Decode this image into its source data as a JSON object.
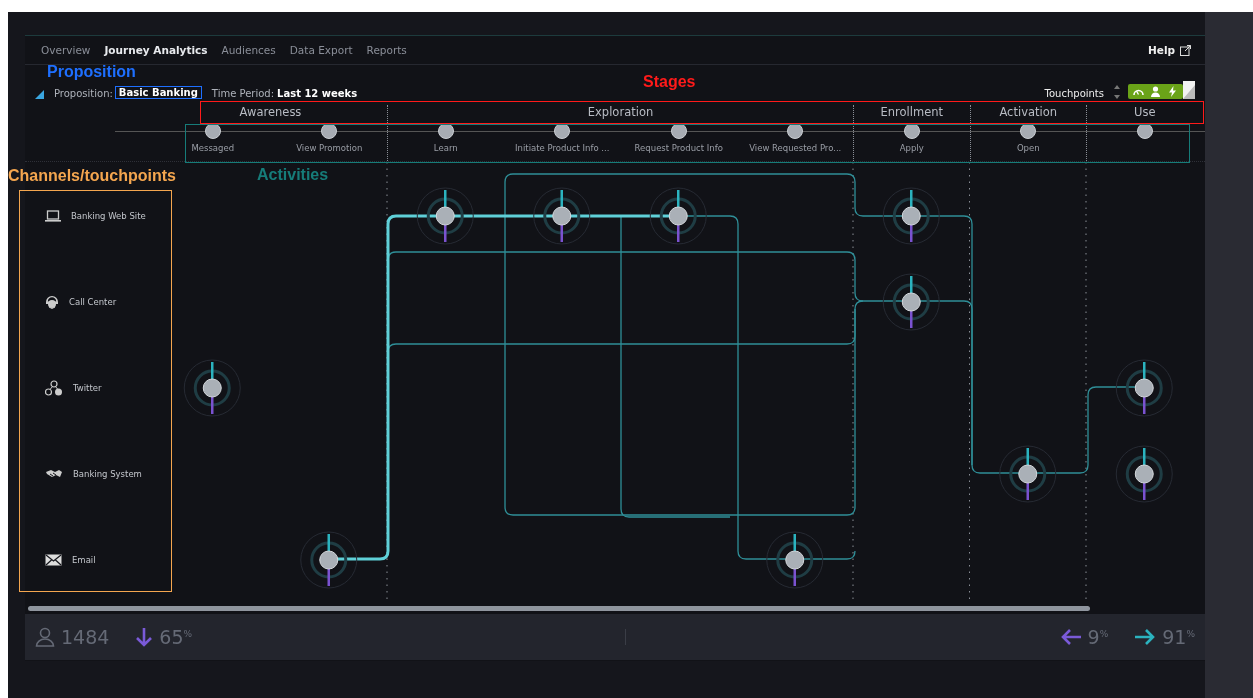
{
  "nav": {
    "tabs": [
      {
        "label": "Overview",
        "selected": false
      },
      {
        "label": "Journey Analytics",
        "selected": true
      },
      {
        "label": "Audiences",
        "selected": false
      },
      {
        "label": "Data Export",
        "selected": false
      },
      {
        "label": "Reports",
        "selected": false
      }
    ],
    "help": "Help"
  },
  "filters": {
    "proposition_label": "Proposition:",
    "proposition": "Basic Banking",
    "period_label": "Time Period:",
    "period": "Last 12 weeks",
    "view": "Touchpoints",
    "modes": [
      {
        "kind": "gauge"
      },
      {
        "kind": "person"
      },
      {
        "kind": "bolt"
      }
    ]
  },
  "stages": [
    {
      "label": "Awareness",
      "activities": [
        {
          "kind": "step",
          "label": "Messaged",
          "nodes": [
            {
              "kind": "network"
            }
          ]
        },
        {
          "kind": "step",
          "label": "View Promotion",
          "nodes": [
            {
              "kind": "envelope"
            }
          ]
        }
      ]
    },
    {
      "label": "Exploration",
      "activities": [
        {
          "kind": "step",
          "label": "Learn",
          "nodes": [
            {
              "kind": "laptop"
            }
          ]
        },
        {
          "kind": "step",
          "label": "Initiate Product Info ...",
          "nodes": [
            {
              "kind": "laptop"
            }
          ]
        },
        {
          "kind": "step",
          "label": "Request Product Info",
          "nodes": [
            {
              "kind": "laptop"
            }
          ]
        },
        {
          "kind": "step",
          "label": "View Requested Pro...",
          "nodes": [
            {
              "kind": "envelope"
            }
          ]
        }
      ]
    },
    {
      "label": "Enrollment",
      "activities": [
        {
          "kind": "step",
          "label": "Apply",
          "nodes": [
            {
              "kind": "laptop"
            },
            {
              "kind": "headset"
            }
          ]
        }
      ]
    },
    {
      "label": "Activation",
      "activities": [
        {
          "kind": "step",
          "label": "Open",
          "nodes": [
            {
              "kind": "handshake"
            }
          ]
        }
      ]
    },
    {
      "label": "Use",
      "activities": [
        {
          "kind": "step",
          "nodes": [
            {
              "kind": "network"
            },
            {
              "kind": "handshake"
            }
          ]
        }
      ]
    }
  ],
  "channels": [
    {
      "label": "Banking Web Site",
      "kind": "laptop"
    },
    {
      "label": "Call Center",
      "kind": "headset"
    },
    {
      "label": "Twitter",
      "kind": "network"
    },
    {
      "label": "Banking System",
      "kind": "handshake"
    },
    {
      "label": "Email",
      "kind": "envelope"
    }
  ],
  "summary": {
    "visitors": "1484",
    "dropoff": "65$^{%}$",
    "back": "9$^{%}$",
    "forward": "91$^{%}$"
  },
  "annotations": [
    {
      "kind": "proposition",
      "label": "Proposition",
      "color": "#1e6fff"
    },
    {
      "kind": "stages",
      "label": "Stages",
      "color": "#ff1a1a"
    },
    {
      "kind": "channels",
      "label": "Channels/touchpoints",
      "color": "#f4a64f"
    },
    {
      "kind": "activities",
      "label": "Activities",
      "color": "#167c79"
    }
  ]
}
